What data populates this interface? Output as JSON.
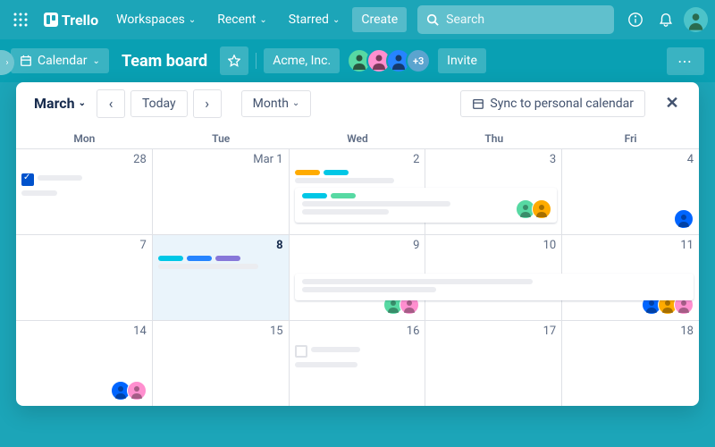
{
  "topbar": {
    "logo": "Trello",
    "nav": [
      "Workspaces",
      "Recent",
      "Starred"
    ],
    "create": "Create",
    "search_placeholder": "Search"
  },
  "boardbar": {
    "view_button": "Calendar",
    "title": "Team board",
    "workspace": "Acme, Inc.",
    "member_overflow": "+3",
    "invite": "Invite"
  },
  "calendar": {
    "month": "March",
    "today_btn": "Today",
    "view_btn": "Month",
    "sync_btn": "Sync to personal calendar",
    "day_headers": [
      "Mon",
      "Tue",
      "Wed",
      "Thu",
      "Fri"
    ],
    "weeks": [
      [
        {
          "num": "28",
          "checked_card": true
        },
        {
          "num": "Mar 1"
        },
        {
          "num": "2",
          "labels": [
            "#ffab00",
            "#00c7e6"
          ],
          "lines": 1
        },
        {
          "num": "3"
        },
        {
          "num": "4",
          "avatars_right": [
            {
              "bg": "#0065ff"
            }
          ]
        }
      ],
      [
        {
          "num": "7"
        },
        {
          "num": "8",
          "today": true,
          "labels": [
            "#00c7e6",
            "#2684ff",
            "#8777d9"
          ],
          "lines": 1
        },
        {
          "num": "9",
          "avatars_right": [
            {
              "bg": "#57d9a3"
            },
            {
              "bg": "#ff8fcf"
            }
          ]
        },
        {
          "num": "10"
        },
        {
          "num": "11",
          "avatars_right": [
            {
              "bg": "#0065ff"
            },
            {
              "bg": "#ffab00"
            },
            {
              "bg": "#ff8fcf"
            }
          ]
        }
      ],
      [
        {
          "num": "14",
          "avatars_right": [
            {
              "bg": "#0065ff"
            },
            {
              "bg": "#ff8fcf"
            }
          ]
        },
        {
          "num": "15"
        },
        {
          "num": "16",
          "unchecked_card": true
        },
        {
          "num": "17"
        },
        {
          "num": "18"
        }
      ]
    ],
    "span_cards": [
      {
        "row": 0,
        "col_start": 2,
        "col_end": 4,
        "labels": [
          "#00c7e6",
          "#57d9a3"
        ],
        "avatars": [
          {
            "bg": "#57d9a3"
          },
          {
            "bg": "#ffab00"
          }
        ]
      },
      {
        "row": 1,
        "col_start": 2,
        "col_end": 5
      }
    ]
  },
  "colors": {
    "avatar_topbar": "#4cc3c9",
    "member1": "#57d9a3",
    "member2": "#ff8fcf",
    "member3": "#2684ff",
    "member_more": "#5ba4cf"
  }
}
